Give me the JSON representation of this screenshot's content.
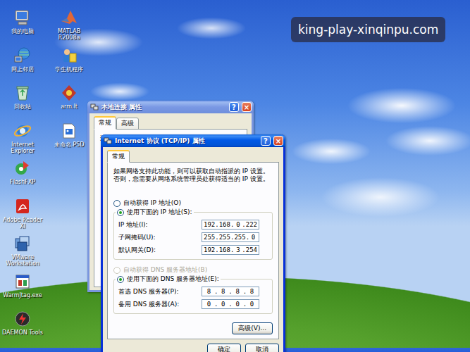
{
  "watermark": "king-play-xinqinpu.com",
  "desktop_icons": [
    {
      "label": "我的电脑",
      "kind": "computer"
    },
    {
      "label": "网上邻居",
      "kind": "network"
    },
    {
      "label": "回收站",
      "kind": "recycle"
    },
    {
      "label": "Internet Explorer",
      "kind": "ie"
    },
    {
      "label": "FlashFXP",
      "kind": "flashfxp"
    },
    {
      "label": "Adobe Reader XI",
      "kind": "pdf"
    },
    {
      "label": "VMware Workstation",
      "kind": "vmware"
    },
    {
      "label": "WarmJtag.exe",
      "kind": "exe"
    },
    {
      "label": "DAEMON Tools",
      "kind": "daemon"
    },
    {
      "label": "MATLAB R2008a",
      "kind": "matlab"
    },
    {
      "label": "学生机程序",
      "kind": "program"
    },
    {
      "label": "arm.lt",
      "kind": "arm"
    },
    {
      "label": "未命名.PSD",
      "kind": "psd"
    }
  ],
  "back_window": {
    "title": "本地连接 属性",
    "help_button": "?",
    "close_button": "×",
    "tabs": [
      {
        "label": "常规",
        "selected": true
      },
      {
        "label": "高级",
        "selected": false
      }
    ],
    "content": "连接时使用:"
  },
  "dialog": {
    "title": "Internet 协议 (TCP/IP) 属性",
    "help_button": "?",
    "close_button": "×",
    "tabs": [
      {
        "label": "常规",
        "selected": true
      }
    ],
    "description": "如果网络支持此功能，则可以获取自动指派的 IP 设置。否则，您需要从网络系统管理员处获得适当的 IP 设置。",
    "octet_separator": ".",
    "ip_mode": [
      {
        "label": "自动获得 IP 地址(O)",
        "selected": false,
        "disabled": false
      },
      {
        "label": "使用下面的 IP 地址(S):",
        "selected": true,
        "disabled": false
      }
    ],
    "ip_fields": [
      {
        "label": "IP 地址(I):",
        "octets": [
          "192",
          "168",
          "0",
          "222"
        ]
      },
      {
        "label": "子网掩码(U):",
        "octets": [
          "255",
          "255",
          "255",
          "0"
        ]
      },
      {
        "label": "默认网关(D):",
        "octets": [
          "192",
          "168",
          "3",
          "254"
        ]
      }
    ],
    "dns_mode": [
      {
        "label": "自动获得 DNS 服务器地址(B)",
        "selected": false,
        "disabled": true
      },
      {
        "label": "使用下面的 DNS 服务器地址(E):",
        "selected": true,
        "disabled": false
      }
    ],
    "dns_fields": [
      {
        "label": "首选 DNS 服务器(P):",
        "octets": [
          "8",
          "8",
          "8",
          "8"
        ]
      },
      {
        "label": "备用 DNS 服务器(A):",
        "octets": [
          "0",
          "0",
          "0",
          "0"
        ]
      }
    ],
    "advanced_button": "高级(V)...",
    "buttons": [
      "确定",
      "取消"
    ]
  }
}
